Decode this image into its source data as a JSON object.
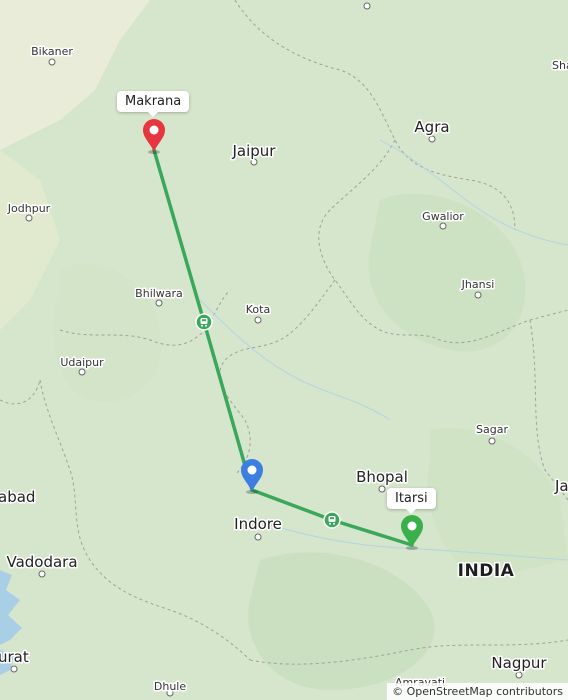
{
  "map": {
    "cities": [
      {
        "name": "Bikaner",
        "size": "small"
      },
      {
        "name": "Jaipur",
        "size": "big"
      },
      {
        "name": "Agra",
        "size": "big"
      },
      {
        "name": "Jodhpur",
        "size": "small"
      },
      {
        "name": "Gwalior",
        "size": "small"
      },
      {
        "name": "Bhilwara",
        "size": "small"
      },
      {
        "name": "Kota",
        "size": "small"
      },
      {
        "name": "Jhansi",
        "size": "small"
      },
      {
        "name": "Udaipur",
        "size": "small"
      },
      {
        "name": "Sagar",
        "size": "small"
      },
      {
        "name": "Bhopal",
        "size": "big"
      },
      {
        "name": "Indore",
        "size": "big"
      },
      {
        "name": "Vadodara",
        "size": "big"
      },
      {
        "name": "Nagpur",
        "size": "big"
      },
      {
        "name": "Dhule",
        "size": "small"
      },
      {
        "name": "Amravati",
        "size": "small"
      }
    ],
    "edge_labels": {
      "left_top": "abad",
      "left_bottom": "urat",
      "right_top": "Sha",
      "right_mid": "Ja"
    },
    "country_label": "INDIA",
    "route_color": "#3aa85b",
    "markers": {
      "origin": {
        "label": "Makrana",
        "color": "#e5373d"
      },
      "waypoint": {
        "color": "#3d7fe0"
      },
      "destination": {
        "label": "Itarsi",
        "color": "#39b04a"
      }
    },
    "attribution": "© OpenStreetMap contributors"
  }
}
